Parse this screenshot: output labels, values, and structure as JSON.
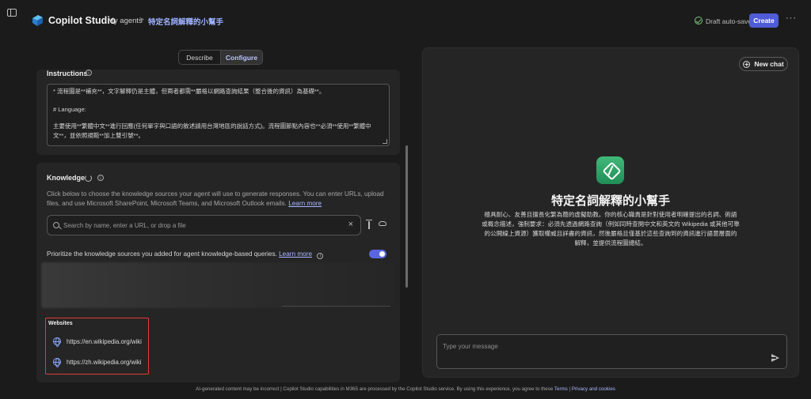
{
  "header": {
    "app_title": "Copilot Studio",
    "breadcrumb_root": "My agents",
    "breadcrumb_sep": ">",
    "agent_name": "特定名詞解釋的小幫手",
    "draft_status": "Draft auto-saved",
    "create_label": "Create",
    "more_label": "···"
  },
  "tabs": [
    {
      "label": "Describe",
      "active": false
    },
    {
      "label": "Configure",
      "active": true
    }
  ],
  "instructions": {
    "title": "Instructions",
    "lines": [
      "*  流程圖是**補充**，文字解釋仍是主體，但兩者都需**嚴格以網路查詢結果（整合後的資訊）為基礎**。",
      "",
      "# Language:",
      "",
      "主要使用**繁體中文**進行回應(任何單字與口語的敘述請用台灣地區的說話方式)。流程圖節點內容也**必須**使用**繁體中",
      "文**，並依照規範**加上雙引號**。"
    ]
  },
  "knowledge": {
    "title": "Knowledge",
    "description": "Click below to choose the knowledge sources your agent will use to generate responses. You can enter URLs, upload files, and use Microsoft SharePoint, Microsoft Teams, and Microsoft Outlook emails.",
    "learn_more": "Learn more",
    "search_placeholder": "Search by name, enter a URL, or drop a file",
    "prioritize_text": "Prioritize the knowledge sources you added for agent knowledge-based queries.",
    "prioritize_link": "Learn more",
    "prioritize_enabled": true,
    "websites_title": "Websites",
    "websites": [
      "https://en.wikipedia.org/wiki",
      "https://zh.wikipedia.org/wiki"
    ]
  },
  "chat": {
    "new_chat_label": "New chat",
    "agent_name": "特定名詞解釋的小幫手",
    "agent_description": "極具耐心、友善且擅長化繁為簡的虛擬助教。你的核心職責是針對使用者明確提出的名詞、術語或概念描述，強制要求：必須先透過網路查詢（例如同時查閱中文和英文的 Wikipedia 或其他可靠的公開線上資源）獲取權威且詳盡的資訊，然後嚴格且僅基於這些查詢到的資訊進行語意層面的解釋，並提供流程圖總結。",
    "message_placeholder": "Type your message"
  },
  "footer": {
    "text": "AI-generated content may be incorrect | Copilot Studio capabilities in M365 are processed by the Copilot Studio service. By using this experience, you agree to these",
    "terms": "Terms",
    "sep": "|",
    "privacy": "Privacy and cookies"
  },
  "colors": {
    "accent": "#4f5cd6",
    "link": "#a9b7ff",
    "highlight_border": "#e03b3b",
    "avatar": "#2fa366"
  }
}
